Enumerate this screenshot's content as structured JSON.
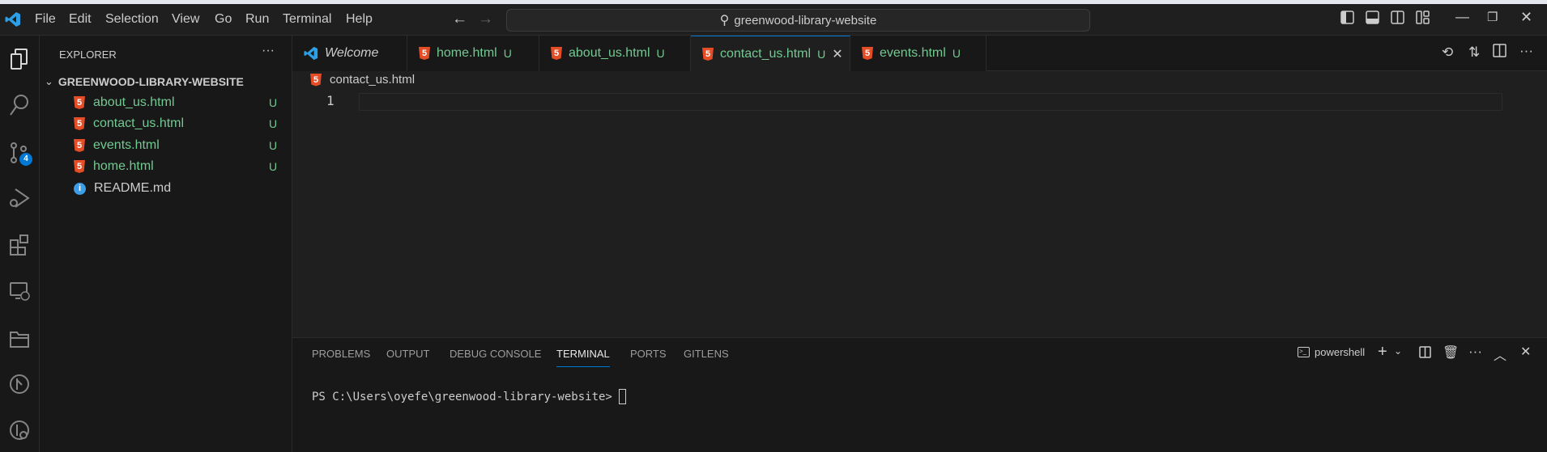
{
  "titlebar": {
    "menu": [
      "File",
      "Edit",
      "Selection",
      "View",
      "Go",
      "Run",
      "Terminal",
      "Help"
    ],
    "search": "greenwood-library-website"
  },
  "activity": {
    "scm_badge": "4"
  },
  "explorer": {
    "title": "EXPLORER",
    "folder": "GREENWOOD-LIBRARY-WEBSITE",
    "files": [
      {
        "name": "about_us.html",
        "status": "U"
      },
      {
        "name": "contact_us.html",
        "status": "U"
      },
      {
        "name": "events.html",
        "status": "U"
      },
      {
        "name": "home.html",
        "status": "U"
      },
      {
        "name": "README.md",
        "status": ""
      }
    ]
  },
  "tabs": [
    {
      "label": "Welcome",
      "status": ""
    },
    {
      "label": "home.html",
      "status": "U"
    },
    {
      "label": "about_us.html",
      "status": "U"
    },
    {
      "label": "contact_us.html",
      "status": "U"
    },
    {
      "label": "events.html",
      "status": "U"
    }
  ],
  "editor": {
    "breadcrumb": "contact_us.html",
    "line_number": "1"
  },
  "panel": {
    "tabs": [
      "PROBLEMS",
      "OUTPUT",
      "DEBUG CONSOLE",
      "TERMINAL",
      "PORTS",
      "GITLENS"
    ],
    "shell": "powershell",
    "prompt": "PS C:\\Users\\oyefe\\greenwood-library-website> "
  }
}
